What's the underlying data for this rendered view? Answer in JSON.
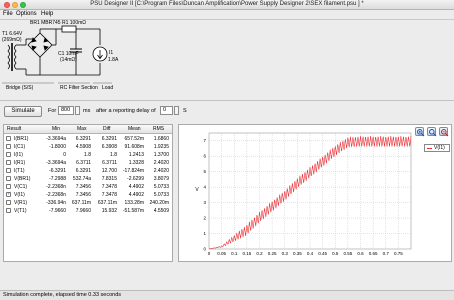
{
  "window": {
    "title": "PSU Designer II   [C:\\Program Files\\Duncan Amplification\\Power Supply Designer 2\\SEX filament.psu ] *"
  },
  "menu": {
    "items": [
      "File",
      "Options",
      "Help"
    ]
  },
  "schematic": {
    "transformer_label": "T1 6.64V",
    "transformer_sub": "(269mΩ)",
    "rectifier_label": "BR1 MBR745",
    "resistor_label": "R1 100mΩ",
    "cap_label": "C1 10mF",
    "cap_sub": "(14mΩ)",
    "load_label": "I1",
    "load_value": "1.8A",
    "section_bridge": "Bridge (S/S)",
    "section_filter": "RC Filter Section",
    "section_load": "Load"
  },
  "controls": {
    "simulate_label": "Simulate",
    "for_label": "For",
    "for_value": "800",
    "ms_label": "ms",
    "after_label": "after a reporting delay of",
    "delay_value": "0",
    "s_label": "S"
  },
  "table": {
    "columns": [
      "Result",
      "Min",
      "Max",
      "Diff",
      "Mean",
      "RMS"
    ],
    "rows": [
      {
        "name": "I(BR1)",
        "checked": false,
        "min": "-3.3694a",
        "max": "6.3291",
        "diff": "6.3291",
        "mean": "657.52m",
        "rms": "1.6860"
      },
      {
        "name": "I(C1)",
        "checked": false,
        "min": "-1.8000",
        "max": "4.5908",
        "diff": "6.3908",
        "mean": "91.608m",
        "rms": "1.9235"
      },
      {
        "name": "I(I1)",
        "checked": false,
        "min": "0",
        "max": "1.8",
        "diff": "1.8",
        "mean": "1.2413",
        "rms": "1.3700"
      },
      {
        "name": "I(R1)",
        "checked": false,
        "min": "-3.3694a",
        "max": "6.3711",
        "diff": "6.3711",
        "mean": "1.3328",
        "rms": "2.4020"
      },
      {
        "name": "I(T1)",
        "checked": false,
        "min": "-6.3291",
        "max": "6.3291",
        "diff": "12.700",
        "mean": "-17.824m",
        "rms": "2.4020"
      },
      {
        "name": "V(BR1)",
        "checked": false,
        "min": "-7.2988",
        "max": "532.74a",
        "diff": "7.8315",
        "mean": "-2.6299",
        "rms": "3.8079"
      },
      {
        "name": "V(C1)",
        "checked": false,
        "min": "-2.2368n",
        "max": "7.3456",
        "diff": "7.3478",
        "mean": "4.4902",
        "rms": "5.0733"
      },
      {
        "name": "V(I1)",
        "checked": true,
        "min": "-2.2368n",
        "max": "7.3456",
        "diff": "7.3478",
        "mean": "4.4902",
        "rms": "5.0733"
      },
      {
        "name": "V(R1)",
        "checked": false,
        "min": "-336.94n",
        "max": "637.11m",
        "diff": "637.11m",
        "mean": "133.28m",
        "rms": "240.20m"
      },
      {
        "name": "V(T1)",
        "checked": false,
        "min": "-7.9660",
        "max": "7.9660",
        "diff": "15.932",
        "mean": "-51.587m",
        "rms": "4.5509"
      }
    ]
  },
  "chart_data": {
    "type": "line",
    "xlabel": "",
    "ylabel": "V",
    "xlim": [
      0,
      0.8
    ],
    "ylim": [
      0,
      7.5
    ],
    "x_ticks": [
      "0",
      "0.05",
      "0.1",
      "0.15",
      "0.2",
      "0.25",
      "0.3",
      "0.35",
      "0.4",
      "0.45",
      "0.5",
      "0.55",
      "0.6",
      "0.65",
      "0.7",
      "0.75"
    ],
    "y_ticks": [
      "0",
      "1",
      "2",
      "3",
      "4",
      "5",
      "6",
      "7"
    ],
    "grid": true,
    "series": [
      {
        "name": "V(I1)",
        "color": "#e8343a",
        "x": [
          0.0,
          0.05,
          0.1,
          0.15,
          0.2,
          0.25,
          0.3,
          0.35,
          0.4,
          0.45,
          0.5,
          0.55,
          0.6,
          0.65,
          0.7,
          0.75,
          0.8
        ],
        "y": [
          0.0,
          0.2,
          0.9,
          1.6,
          2.4,
          3.1,
          3.8,
          4.6,
          5.3,
          6.0,
          6.7,
          7.25,
          7.3,
          7.3,
          7.3,
          7.3,
          7.3
        ],
        "ripple": 0.7
      }
    ],
    "legend_position": "top-right"
  },
  "chart_tools": {
    "icons": [
      "zoom-in-icon",
      "zoom-fit-icon",
      "zoom-out-icon"
    ]
  },
  "status": {
    "text": "Simulation complete, elapsed time 0.33 seconds"
  }
}
